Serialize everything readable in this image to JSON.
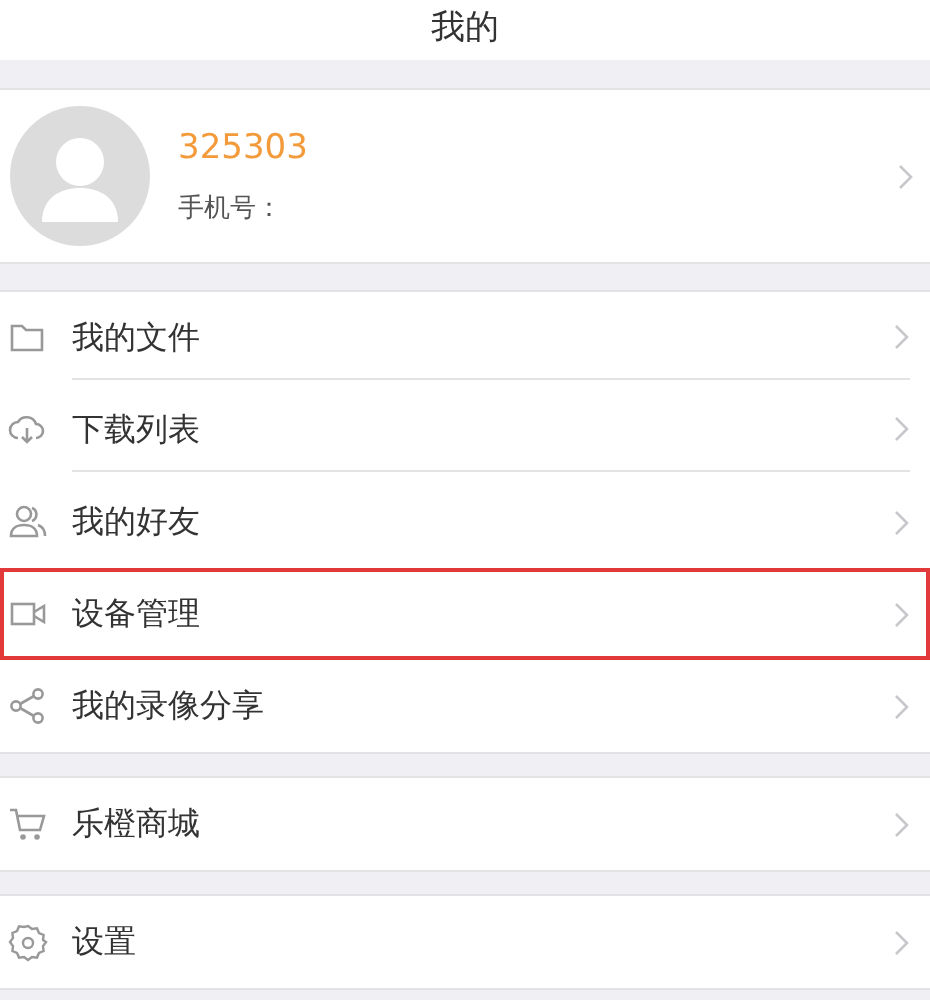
{
  "header": {
    "title": "我的"
  },
  "profile": {
    "user_id": "325303",
    "phone_label": "手机号："
  },
  "groups": [
    {
      "items": [
        {
          "kind": "folder",
          "label": "我的文件",
          "highlighted": false
        },
        {
          "kind": "cloud",
          "label": "下载列表",
          "highlighted": false
        },
        {
          "kind": "people",
          "label": "我的好友",
          "highlighted": false
        },
        {
          "kind": "camera",
          "label": "设备管理",
          "highlighted": true
        },
        {
          "kind": "share",
          "label": "我的录像分享",
          "highlighted": false
        }
      ]
    },
    {
      "items": [
        {
          "kind": "cart",
          "label": "乐橙商城",
          "highlighted": false
        }
      ]
    },
    {
      "items": [
        {
          "kind": "gear",
          "label": "设置",
          "highlighted": false
        }
      ]
    }
  ]
}
